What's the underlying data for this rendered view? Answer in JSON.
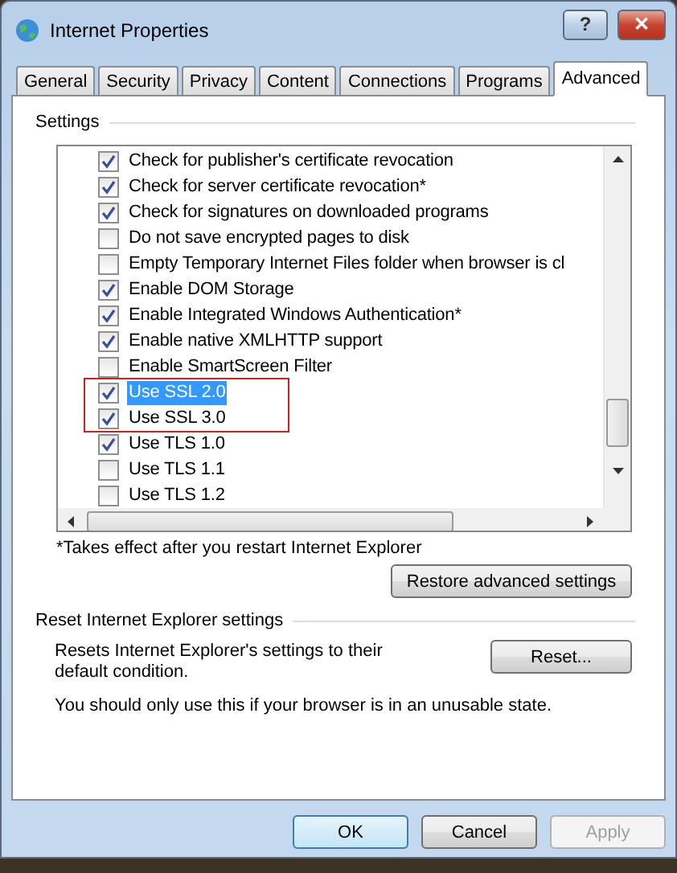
{
  "window": {
    "title": "Internet Properties"
  },
  "caption_buttons": [
    {
      "kind": "help",
      "label": "?"
    },
    {
      "kind": "close",
      "label": "✕"
    }
  ],
  "tabs": [
    {
      "label": "General",
      "selected": false
    },
    {
      "label": "Security",
      "selected": false
    },
    {
      "label": "Privacy",
      "selected": false
    },
    {
      "label": "Content",
      "selected": false
    },
    {
      "label": "Connections",
      "selected": false
    },
    {
      "label": "Programs",
      "selected": false
    },
    {
      "label": "Advanced",
      "selected": true
    }
  ],
  "settings": {
    "title": "Settings",
    "items": [
      {
        "label": "Check for publisher's certificate revocation",
        "checked": true,
        "selected": false,
        "boxed": false
      },
      {
        "label": "Check for server certificate revocation*",
        "checked": true,
        "selected": false,
        "boxed": false
      },
      {
        "label": "Check for signatures on downloaded programs",
        "checked": true,
        "selected": false,
        "boxed": false
      },
      {
        "label": "Do not save encrypted pages to disk",
        "checked": false,
        "selected": false,
        "boxed": false
      },
      {
        "label": "Empty Temporary Internet Files folder when browser is cl",
        "checked": false,
        "selected": false,
        "boxed": false
      },
      {
        "label": "Enable DOM Storage",
        "checked": true,
        "selected": false,
        "boxed": false
      },
      {
        "label": "Enable Integrated Windows Authentication*",
        "checked": true,
        "selected": false,
        "boxed": false
      },
      {
        "label": "Enable native XMLHTTP support",
        "checked": true,
        "selected": false,
        "boxed": false
      },
      {
        "label": "Enable SmartScreen Filter",
        "checked": false,
        "selected": false,
        "boxed": false
      },
      {
        "label": "Use SSL 2.0",
        "checked": true,
        "selected": true,
        "boxed": true
      },
      {
        "label": "Use SSL 3.0",
        "checked": true,
        "selected": false,
        "boxed": true
      },
      {
        "label": "Use TLS 1.0",
        "checked": true,
        "selected": false,
        "boxed": false
      },
      {
        "label": "Use TLS 1.1",
        "checked": false,
        "selected": false,
        "boxed": false
      },
      {
        "label": "Use TLS 1.2",
        "checked": false,
        "selected": false,
        "boxed": false
      }
    ],
    "footnote": "*Takes effect after you restart Internet Explorer",
    "restore_button": "Restore advanced settings"
  },
  "reset": {
    "title": "Reset Internet Explorer settings",
    "description": "Resets Internet Explorer's settings to their default condition.",
    "button": "Reset...",
    "note": "You should only use this if your browser is in an unusable state."
  },
  "buttons": [
    {
      "label": "OK",
      "disabled": false,
      "default": true
    },
    {
      "label": "Cancel",
      "disabled": false,
      "default": false
    },
    {
      "label": "Apply",
      "disabled": true,
      "default": false
    }
  ]
}
